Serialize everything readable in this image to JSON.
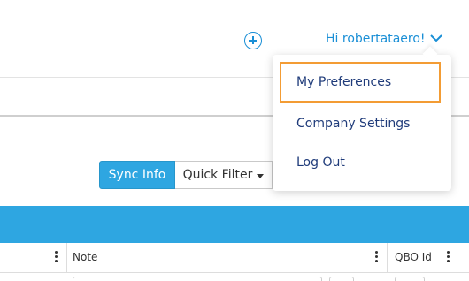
{
  "header": {
    "greeting": "Hi robertataero!",
    "add_icon": "plus-circle-icon",
    "dropdown_icon": "chevron-down-icon"
  },
  "toolbar": {
    "sync_info_label": "Sync Info",
    "quick_filter_label": "Quick Filter"
  },
  "table": {
    "columns": [
      "Note",
      "QBO Id"
    ]
  },
  "user_menu": {
    "items": [
      {
        "label": "My Preferences",
        "highlighted": true
      },
      {
        "label": "Company Settings"
      },
      {
        "label": "Log Out"
      }
    ]
  },
  "colors": {
    "accent": "#2ea6e1",
    "link": "#1a8fd6",
    "menu_text": "#1f3b7a",
    "highlight_border": "#f39c34"
  }
}
